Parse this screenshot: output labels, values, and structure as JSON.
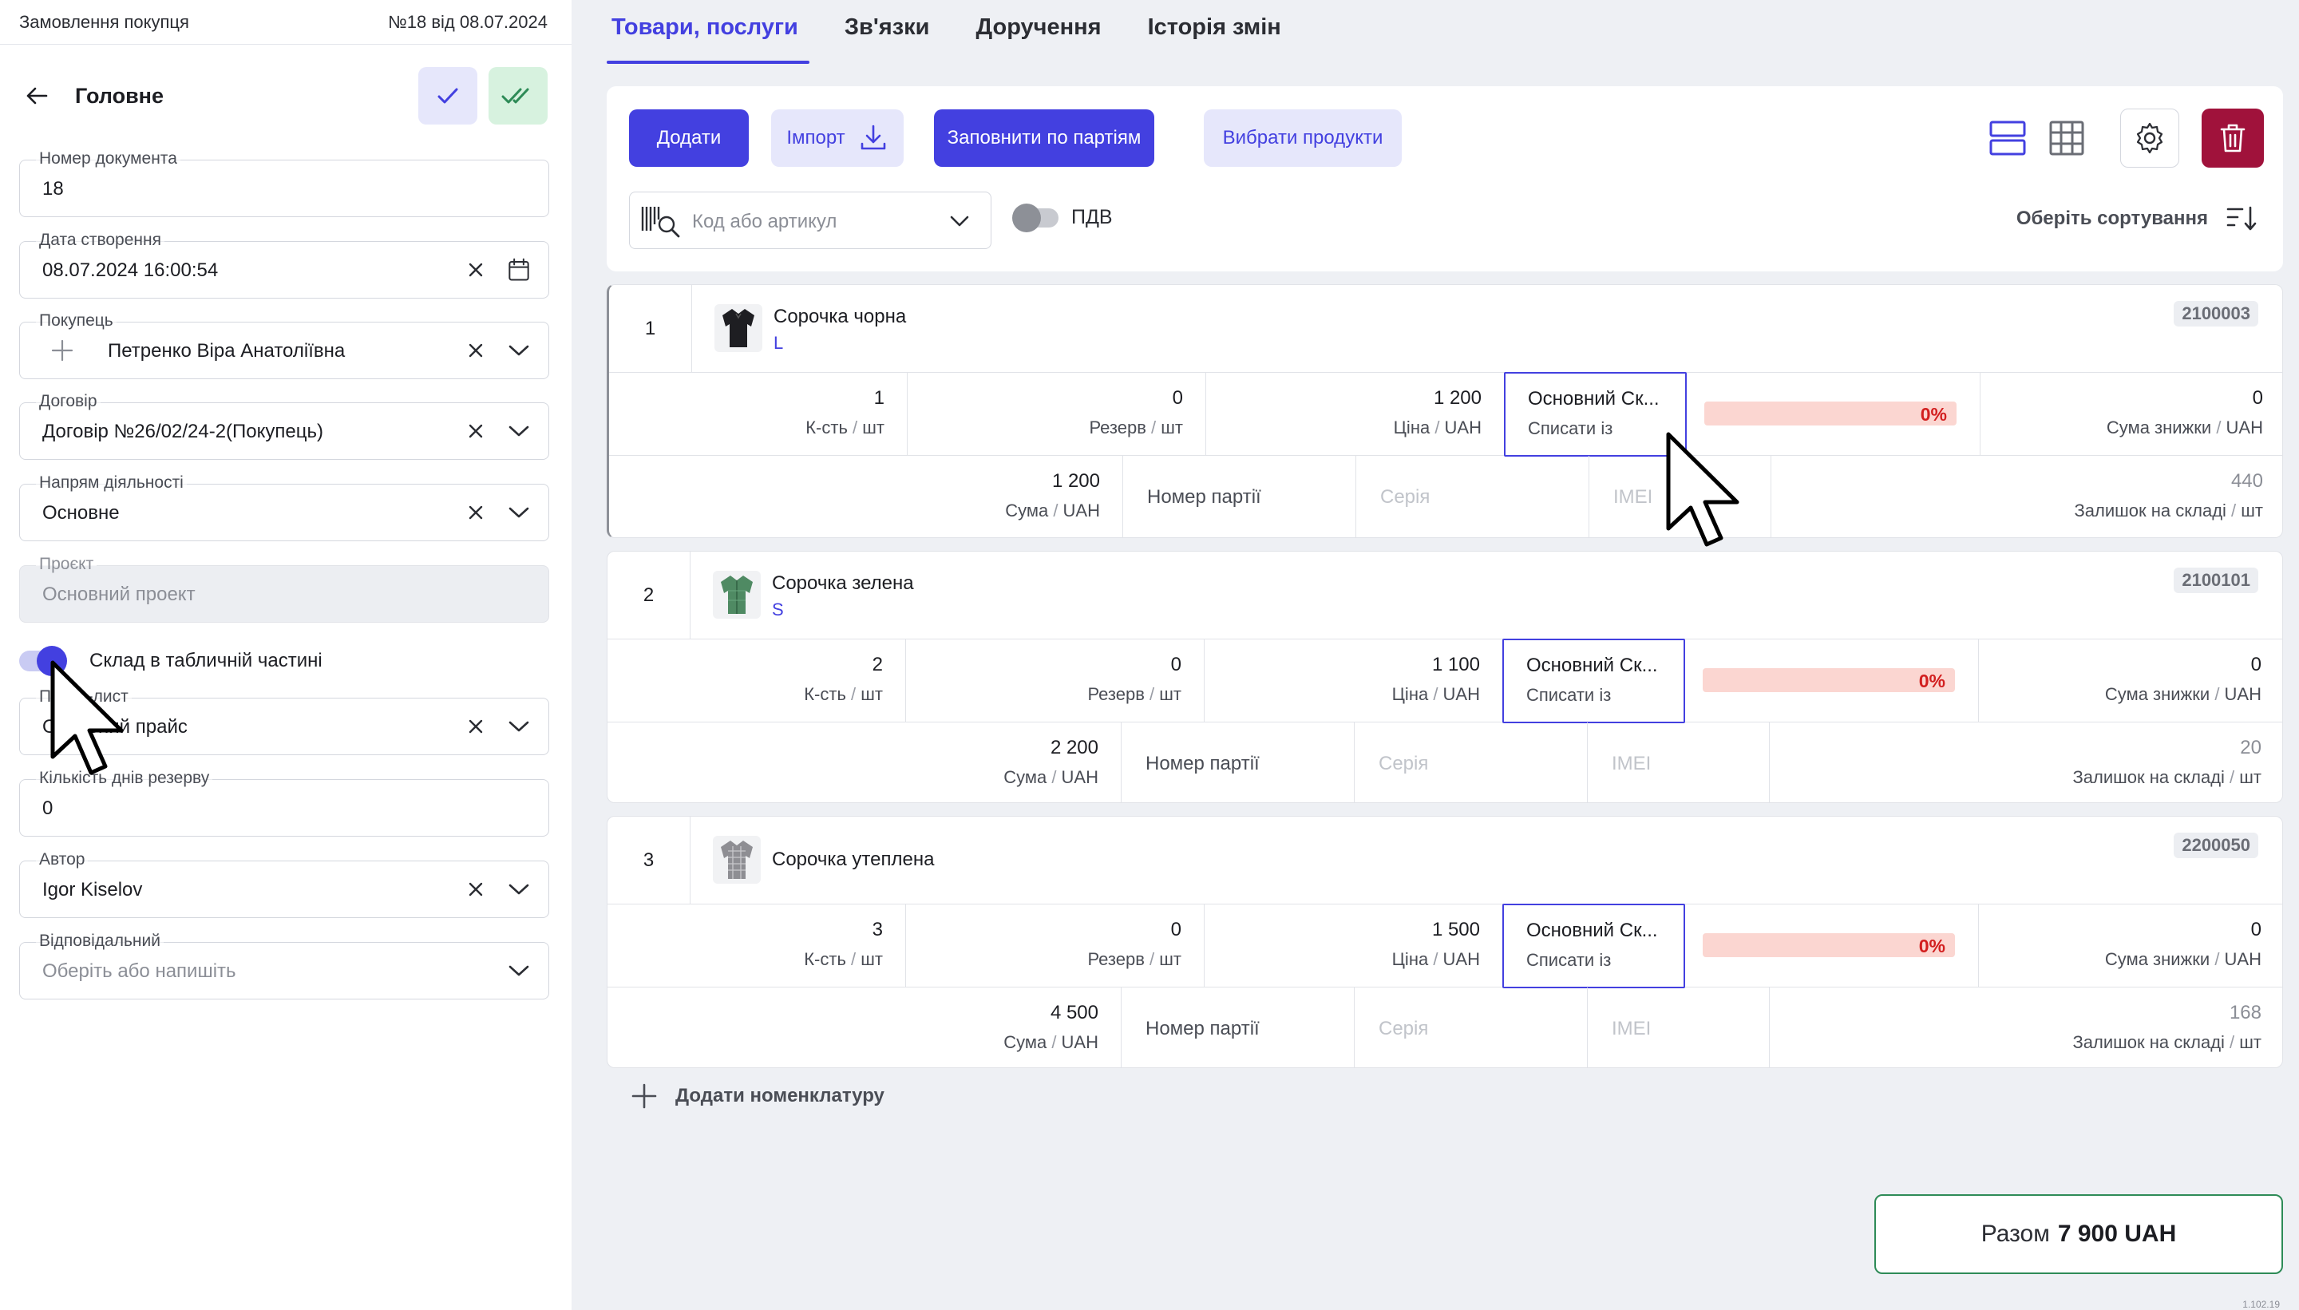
{
  "left": {
    "doc_type": "Замовлення покупця",
    "doc_ref": "№18 від 08.07.2024",
    "title": "Головне",
    "fields": {
      "doc_number": {
        "label": "Номер документа",
        "value": "18"
      },
      "created": {
        "label": "Дата створення",
        "value": "08.07.2024 16:00:54"
      },
      "buyer": {
        "label": "Покупець",
        "value": "Петренко Віра Анатоліївна"
      },
      "contract": {
        "label": "Договір",
        "value": "Договір №26/02/24-2(Покупець)"
      },
      "direction": {
        "label": "Напрям діяльності",
        "value": "Основне"
      },
      "project": {
        "label": "Проєкт",
        "value": "Основний проект"
      },
      "warehouse_toggle": {
        "label": "Склад в табличній частині",
        "on": true
      },
      "pricelist": {
        "label": "Прайс-лист",
        "value": "Основний прайс"
      },
      "reserve_days": {
        "label": "Кількість днів резерву",
        "value": "0"
      },
      "author": {
        "label": "Автор",
        "value": "Igor Kiselov"
      },
      "responsible": {
        "label": "Відповідальний",
        "placeholder": "Оберіть або напишіть"
      }
    }
  },
  "tabs": [
    "Товари, послуги",
    "Зв'язки",
    "Доручення",
    "Історія змін"
  ],
  "toolbar": {
    "add": "Додати",
    "import": "Імпорт",
    "fill_batches": "Заповнити по партіям",
    "choose_products": "Вибрати продукти",
    "search_placeholder": "Код або артикул",
    "vat_label": "ПДВ",
    "vat_on": false,
    "sort_label": "Оберіть сортування"
  },
  "labels": {
    "qty": "К-сть",
    "pcs": "шт",
    "reserve": "Резерв",
    "price": "Ціна",
    "currency": "UAH",
    "discount_sum": "Сума знижки",
    "sum": "Сума",
    "batch": "Номер партії",
    "series": "Серія",
    "imei": "IMEI",
    "stock": "Залишок на складі",
    "writeoff": "Списати із"
  },
  "items": [
    {
      "num": "1",
      "name": "Сорочка чорна",
      "size": "L",
      "code": "2100003",
      "qty": "1",
      "reserve": "0",
      "price": "1 200",
      "warehouse": "Основний Ск...",
      "discount": "0%",
      "discount_sum": "0",
      "sum": "1 200",
      "stock": "440"
    },
    {
      "num": "2",
      "name": "Сорочка зелена",
      "size": "S",
      "code": "2100101",
      "qty": "2",
      "reserve": "0",
      "price": "1 100",
      "warehouse": "Основний Ск...",
      "discount": "0%",
      "discount_sum": "0",
      "sum": "2 200",
      "stock": "20"
    },
    {
      "num": "3",
      "name": "Сорочка утеплена",
      "size": "",
      "code": "2200050",
      "qty": "3",
      "reserve": "0",
      "price": "1 500",
      "warehouse": "Основний Ск...",
      "discount": "0%",
      "discount_sum": "0",
      "sum": "4 500",
      "stock": "168"
    }
  ],
  "add_nomenclature": "Додати номенклатуру",
  "total": {
    "label": "Разом",
    "value": "7 900 UAH"
  },
  "version": "1.102.19",
  "colors": {
    "accent": "#4340e0",
    "danger": "#a0123b",
    "success": "#2e8b57",
    "discount_bg": "#fbd6d1"
  }
}
